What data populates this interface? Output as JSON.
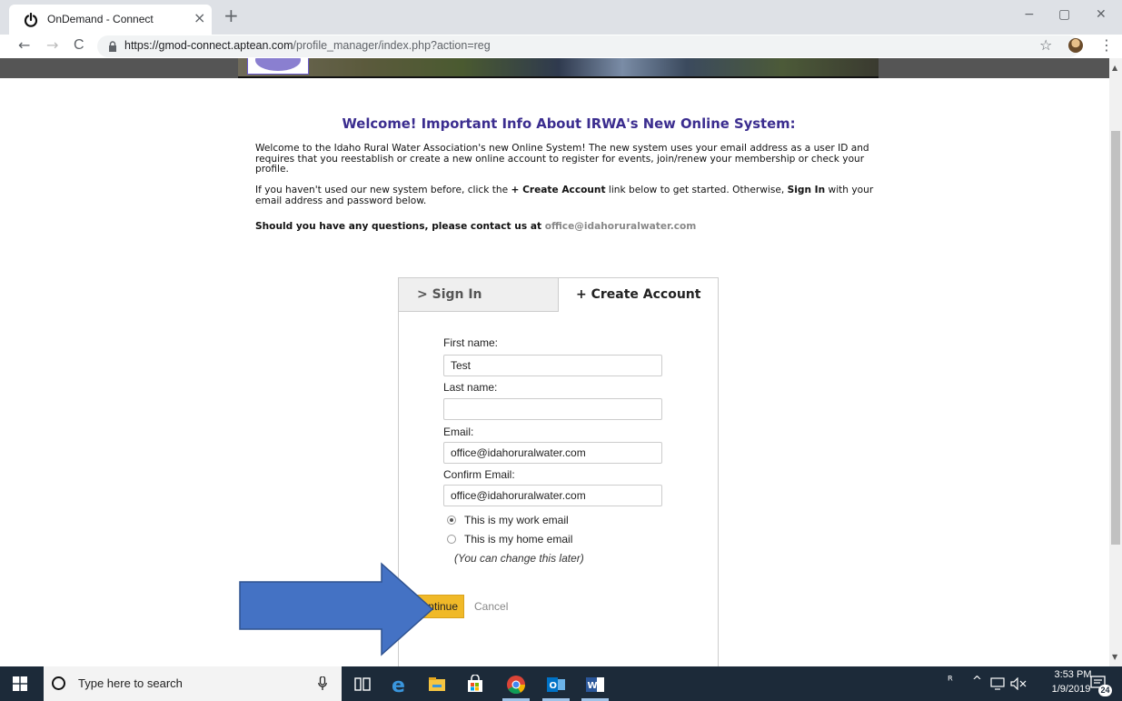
{
  "browser": {
    "tab_title": "OnDemand - Connect",
    "tab_close": "×",
    "new_tab": "+",
    "url_host": "https://gmod-connect.aptean.com",
    "url_path": "/profile_manager/index.php?action=reg",
    "back": "←",
    "forward": "→",
    "reload": "C",
    "star": "☆",
    "menu": "⋮",
    "minimize": "−",
    "maximize": "▢",
    "close": "✕"
  },
  "page": {
    "title": "Welcome! Important Info About IRWA's New Online System:",
    "intro": "Welcome to the Idaho Rural Water Association's new Online System! The new system uses your email address as a user ID and requires that you reestablish or create a new online account to register for events, join/renew your membership or check your profile.",
    "instructions": {
      "part1": "If you haven't used our new system before, click the ",
      "create_account_bold": "+ Create Account",
      "part2": " link below to get started. Otherwise, ",
      "sign_in_bold": "Sign In",
      "part3": " with your email address and password below."
    },
    "contact": {
      "text": "Should you have any questions, please contact us at ",
      "email": "office@idahoruralwater.com"
    }
  },
  "panel": {
    "tab_signin": "> Sign In",
    "tab_create": "+ Create Account",
    "first_name_label": "First name:",
    "first_name_value": "Test",
    "last_name_label": "Last name:",
    "last_name_value": "",
    "email_label": "Email:",
    "email_value": "office@idahoruralwater.com",
    "confirm_email_label": "Confirm Email:",
    "confirm_email_value": "office@idahoruralwater.com",
    "radio_work": "This is my work email",
    "radio_home": "This is my home email",
    "radio_selected": "work",
    "change_note": "(You can change this later)",
    "continue_label": "Continue",
    "cancel_label": "Cancel"
  },
  "taskbar": {
    "search_placeholder": "Type here to search",
    "time": "3:53 PM",
    "date": "1/9/2019",
    "notifications": "24"
  },
  "colors": {
    "title": "#3b2d8f",
    "continue_button": "#f0b928",
    "arrow": "#4472c4",
    "taskbar": "#1c2a39"
  }
}
